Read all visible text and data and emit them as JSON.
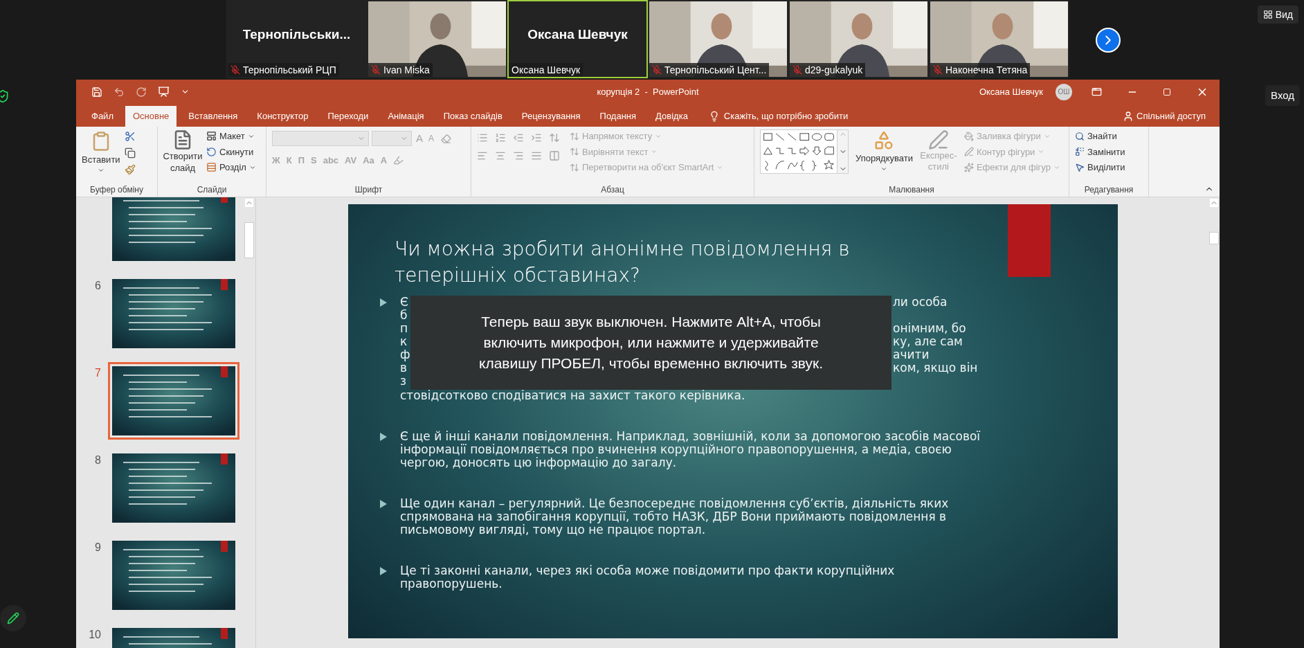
{
  "meeting": {
    "participants": [
      {
        "kind": "name",
        "display": "Тернопільськи...",
        "label": "Тернопільський РЦП",
        "muted": true,
        "active": false
      },
      {
        "kind": "video",
        "label": "Ivan Miska",
        "muted": true,
        "active": false
      },
      {
        "kind": "name",
        "display": "Оксана Шевчук",
        "label": "Оксана Шевчук",
        "muted": false,
        "active": true
      },
      {
        "kind": "video",
        "label": "Тернопільський Цент...",
        "muted": true,
        "active": false
      },
      {
        "kind": "video",
        "label": "d29-gukalyuk",
        "muted": true,
        "active": false
      },
      {
        "kind": "video",
        "label": "Наконечна Тетяна",
        "muted": true,
        "active": false
      }
    ],
    "view_button": "Вид",
    "signin_button": "Вход"
  },
  "powerpoint": {
    "title": "корупція 2  -  PowerPoint",
    "user": "Оксана Шевчук",
    "user_initials": "ОШ",
    "tabs": [
      {
        "label": "Файл",
        "selected": false
      },
      {
        "label": "Основне",
        "selected": true
      },
      {
        "label": "Вставлення",
        "selected": false
      },
      {
        "label": "Конструктор",
        "selected": false
      },
      {
        "label": "Переходи",
        "selected": false
      },
      {
        "label": "Анімація",
        "selected": false
      },
      {
        "label": "Показ слайдів",
        "selected": false
      },
      {
        "label": "Рецензування",
        "selected": false
      },
      {
        "label": "Подання",
        "selected": false
      },
      {
        "label": "Довідка",
        "selected": false
      }
    ],
    "tell_me": "Скажіть, що потрібно зробити",
    "share": "Спільний доступ",
    "ribbon": {
      "clipboard": {
        "label": "Буфер обміну",
        "paste": "Вставити"
      },
      "slides": {
        "label": "Слайди",
        "new_slide": "Створити слайд",
        "layout": "Макет",
        "reset": "Скинути",
        "section": "Розділ"
      },
      "font": {
        "label": "Шрифт",
        "size_buttons": [
          "A",
          "A"
        ],
        "style_buttons": [
          "Ж",
          "К",
          "П",
          "S",
          "abc",
          "AV",
          "Aa",
          "A"
        ]
      },
      "paragraph": {
        "label": "Абзац",
        "commands": [
          {
            "label": "Напрямок тексту",
            "disabled": true
          },
          {
            "label": "Вирівняти текст",
            "disabled": true
          },
          {
            "label": "Перетворити на об'єкт SmartArt",
            "disabled": true
          }
        ]
      },
      "drawing": {
        "label": "Малювання",
        "arrange": "Упорядкувати",
        "quick_styles": {
          "label": "Експрес-стилі",
          "disabled": true
        },
        "commands": [
          {
            "label": "Заливка фігури",
            "disabled": true
          },
          {
            "label": "Контур фігури",
            "disabled": true
          },
          {
            "label": "Ефекти для фігур",
            "disabled": true
          }
        ]
      },
      "editing": {
        "label": "Редагування",
        "commands": [
          "Знайти",
          "Замінити",
          "Виділити"
        ]
      }
    },
    "thumbnails": [
      {
        "selected": false
      },
      {
        "number": "6",
        "selected": false
      },
      {
        "number": "7",
        "selected": true
      },
      {
        "number": "8",
        "selected": false
      },
      {
        "number": "9",
        "selected": false
      },
      {
        "number": "10",
        "selected": false
      }
    ],
    "slide": {
      "title": "Чи можна зробити анонімне повідомлення в теперішніх обставинах?",
      "bullets": [
        {
          "kind": "covered",
          "lines": [
            {
              "left": "Є",
              "right": "ли особа"
            },
            {
              "left": "б"
            },
            {
              "left": "п",
              "right": "онімним, бо"
            },
            {
              "left": "к",
              "right": "ку, але сам"
            },
            {
              "left": "ф",
              "right": "ачити"
            },
            {
              "left": "в",
              "right": "ком, якщо він"
            },
            {
              "left": "з"
            }
          ],
          "last_line": "стовідсотково сподіватися на захист такого керівника."
        },
        {
          "kind": "plain",
          "text": "Є ще й інші канали повідомлення. Наприклад, зовнішній, коли за допомогою засобів масової інформації повідомляється про вчинення корупційного правопорушення, а медіа, своєю чергою, доносять цю інформацію до загалу."
        },
        {
          "kind": "plain",
          "text": "Ще один канал – регулярний. Це безпосереднє повідомлення суб’єктів, діяльність яких спрямована на запобігання корупції, тобто НАЗК, ДБР Вони приймають повідомлення в письмовому вигляді, тому що не працює портал."
        },
        {
          "kind": "plain",
          "text": "Це ті законні канали, через які особа може повідомити про факти корупційних правопорушень."
        }
      ]
    }
  },
  "notification": "Теперь ваш звук выключен. Нажмите Alt+A, чтобы включить микрофон, или нажмите и удерживайте клавишу ПРОБЕЛ, чтобы временно включить звук."
}
